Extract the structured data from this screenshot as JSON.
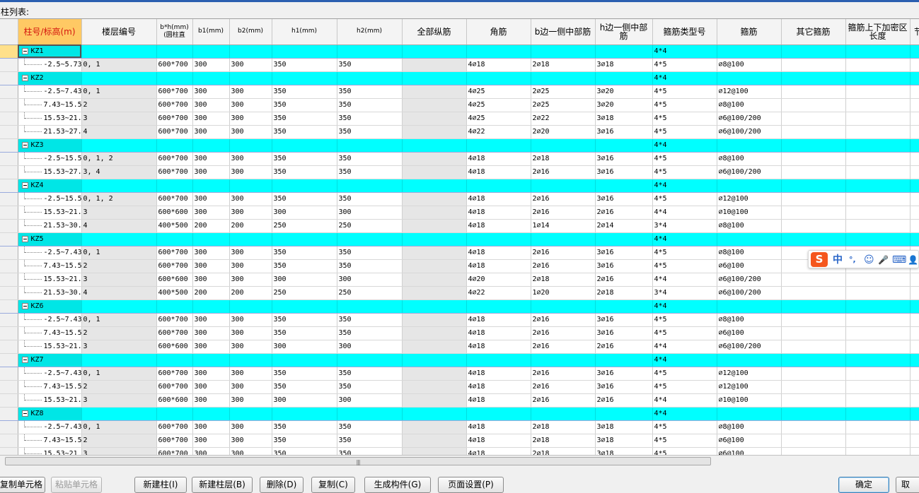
{
  "caption": "柱列表:",
  "columns": [
    {
      "label": "柱号/标高(m)",
      "cls": "first"
    },
    {
      "label": "楼层编号",
      "cls": ""
    },
    {
      "label": "b*h(mm)(圆柱直",
      "cls": "small"
    },
    {
      "label": "b1(mm)",
      "cls": "small"
    },
    {
      "label": "b2(mm)",
      "cls": "small"
    },
    {
      "label": "h1(mm)",
      "cls": "small"
    },
    {
      "label": "h2(mm)",
      "cls": "small"
    },
    {
      "label": "全部纵筋",
      "cls": ""
    },
    {
      "label": "角筋",
      "cls": ""
    },
    {
      "label": "b边一侧中部筋",
      "cls": ""
    },
    {
      "label": "h边一侧中部筋",
      "cls": ""
    },
    {
      "label": "箍筋类型号",
      "cls": ""
    },
    {
      "label": "箍筋",
      "cls": ""
    },
    {
      "label": "其它箍筋",
      "cls": ""
    },
    {
      "label": "箍筋上下加密区长度",
      "cls": ""
    },
    {
      "label": "节",
      "cls": ""
    }
  ],
  "groups": [
    {
      "name": "KZ1",
      "hoop_type": "4*4",
      "selected": true,
      "rows": [
        {
          "elev": "-2.5~5.73",
          "floor": "0, 1",
          "bh": "600*700",
          "b1": "300",
          "b2": "300",
          "h1": "350",
          "h2": "350",
          "all": "",
          "corner": "4⌀18",
          "bmid": "2⌀18",
          "hmid": "3⌀18",
          "htype": "4*5",
          "stirrup": "⌀8@100"
        }
      ]
    },
    {
      "name": "KZ2",
      "hoop_type": "4*4",
      "selected": false,
      "rows": [
        {
          "elev": "-2.5~7.43",
          "floor": "0, 1",
          "bh": "600*700",
          "b1": "300",
          "b2": "300",
          "h1": "350",
          "h2": "350",
          "all": "",
          "corner": "4⌀25",
          "bmid": "2⌀25",
          "hmid": "3⌀20",
          "htype": "4*5",
          "stirrup": "⌀12@100"
        },
        {
          "elev": "7.43~15.5",
          "floor": "2",
          "bh": "600*700",
          "b1": "300",
          "b2": "300",
          "h1": "350",
          "h2": "350",
          "all": "",
          "corner": "4⌀25",
          "bmid": "2⌀25",
          "hmid": "3⌀20",
          "htype": "4*5",
          "stirrup": "⌀8@100"
        },
        {
          "elev": "15.53~21.",
          "floor": "3",
          "bh": "600*700",
          "b1": "300",
          "b2": "300",
          "h1": "350",
          "h2": "350",
          "all": "",
          "corner": "4⌀25",
          "bmid": "2⌀22",
          "hmid": "3⌀18",
          "htype": "4*5",
          "stirrup": "⌀6@100/200"
        },
        {
          "elev": "21.53~27.",
          "floor": "4",
          "bh": "600*700",
          "b1": "300",
          "b2": "300",
          "h1": "350",
          "h2": "350",
          "all": "",
          "corner": "4⌀22",
          "bmid": "2⌀20",
          "hmid": "3⌀16",
          "htype": "4*5",
          "stirrup": "⌀6@100/200"
        }
      ]
    },
    {
      "name": "KZ3",
      "hoop_type": "4*4",
      "selected": false,
      "rows": [
        {
          "elev": "-2.5~15.5",
          "floor": "0, 1, 2",
          "bh": "600*700",
          "b1": "300",
          "b2": "300",
          "h1": "350",
          "h2": "350",
          "all": "",
          "corner": "4⌀18",
          "bmid": "2⌀18",
          "hmid": "3⌀16",
          "htype": "4*5",
          "stirrup": "⌀8@100"
        },
        {
          "elev": "15.53~27.",
          "floor": "3, 4",
          "bh": "600*700",
          "b1": "300",
          "b2": "300",
          "h1": "350",
          "h2": "350",
          "all": "",
          "corner": "4⌀18",
          "bmid": "2⌀16",
          "hmid": "3⌀16",
          "htype": "4*5",
          "stirrup": "⌀6@100/200"
        }
      ]
    },
    {
      "name": "KZ4",
      "hoop_type": "4*4",
      "selected": false,
      "rows": [
        {
          "elev": "-2.5~15.5",
          "floor": "0, 1, 2",
          "bh": "600*700",
          "b1": "300",
          "b2": "300",
          "h1": "350",
          "h2": "350",
          "all": "",
          "corner": "4⌀18",
          "bmid": "2⌀16",
          "hmid": "3⌀16",
          "htype": "4*5",
          "stirrup": "⌀12@100"
        },
        {
          "elev": "15.53~21.",
          "floor": "3",
          "bh": "600*600",
          "b1": "300",
          "b2": "300",
          "h1": "300",
          "h2": "300",
          "all": "",
          "corner": "4⌀18",
          "bmid": "2⌀16",
          "hmid": "2⌀16",
          "htype": "4*4",
          "stirrup": "⌀10@100"
        },
        {
          "elev": "21.53~30.",
          "floor": "4",
          "bh": "400*500",
          "b1": "200",
          "b2": "200",
          "h1": "250",
          "h2": "250",
          "all": "",
          "corner": "4⌀18",
          "bmid": "1⌀14",
          "hmid": "2⌀14",
          "htype": "3*4",
          "stirrup": "⌀8@100"
        }
      ]
    },
    {
      "name": "KZ5",
      "hoop_type": "4*4",
      "selected": false,
      "rows": [
        {
          "elev": "-2.5~7.43",
          "floor": "0, 1",
          "bh": "600*700",
          "b1": "300",
          "b2": "300",
          "h1": "350",
          "h2": "350",
          "all": "",
          "corner": "4⌀18",
          "bmid": "2⌀16",
          "hmid": "3⌀16",
          "htype": "4*5",
          "stirrup": "⌀8@100"
        },
        {
          "elev": "7.43~15.5",
          "floor": "2",
          "bh": "600*700",
          "b1": "300",
          "b2": "300",
          "h1": "350",
          "h2": "350",
          "all": "",
          "corner": "4⌀18",
          "bmid": "2⌀16",
          "hmid": "3⌀16",
          "htype": "4*5",
          "stirrup": "⌀6@100"
        },
        {
          "elev": "15.53~21.",
          "floor": "3",
          "bh": "600*600",
          "b1": "300",
          "b2": "300",
          "h1": "300",
          "h2": "300",
          "all": "",
          "corner": "4⌀20",
          "bmid": "2⌀18",
          "hmid": "2⌀16",
          "htype": "4*4",
          "stirrup": "⌀6@100/200"
        },
        {
          "elev": "21.53~30.",
          "floor": "4",
          "bh": "400*500",
          "b1": "200",
          "b2": "200",
          "h1": "250",
          "h2": "250",
          "all": "",
          "corner": "4⌀22",
          "bmid": "1⌀20",
          "hmid": "2⌀18",
          "htype": "3*4",
          "stirrup": "⌀6@100/200"
        }
      ]
    },
    {
      "name": "KZ6",
      "hoop_type": "4*4",
      "selected": false,
      "rows": [
        {
          "elev": "-2.5~7.43",
          "floor": "0, 1",
          "bh": "600*700",
          "b1": "300",
          "b2": "300",
          "h1": "350",
          "h2": "350",
          "all": "",
          "corner": "4⌀18",
          "bmid": "2⌀16",
          "hmid": "3⌀16",
          "htype": "4*5",
          "stirrup": "⌀8@100"
        },
        {
          "elev": "7.43~15.5",
          "floor": "2",
          "bh": "600*700",
          "b1": "300",
          "b2": "300",
          "h1": "350",
          "h2": "350",
          "all": "",
          "corner": "4⌀18",
          "bmid": "2⌀16",
          "hmid": "3⌀16",
          "htype": "4*5",
          "stirrup": "⌀6@100"
        },
        {
          "elev": "15.53~21.",
          "floor": "3",
          "bh": "600*600",
          "b1": "300",
          "b2": "300",
          "h1": "300",
          "h2": "300",
          "all": "",
          "corner": "4⌀18",
          "bmid": "2⌀16",
          "hmid": "2⌀16",
          "htype": "4*4",
          "stirrup": "⌀6@100/200"
        }
      ]
    },
    {
      "name": "KZ7",
      "hoop_type": "4*4",
      "selected": false,
      "rows": [
        {
          "elev": "-2.5~7.43",
          "floor": "0, 1",
          "bh": "600*700",
          "b1": "300",
          "b2": "300",
          "h1": "350",
          "h2": "350",
          "all": "",
          "corner": "4⌀18",
          "bmid": "2⌀16",
          "hmid": "3⌀16",
          "htype": "4*5",
          "stirrup": "⌀12@100"
        },
        {
          "elev": "7.43~15.5",
          "floor": "2",
          "bh": "600*700",
          "b1": "300",
          "b2": "300",
          "h1": "350",
          "h2": "350",
          "all": "",
          "corner": "4⌀18",
          "bmid": "2⌀16",
          "hmid": "3⌀16",
          "htype": "4*5",
          "stirrup": "⌀12@100"
        },
        {
          "elev": "15.53~21.",
          "floor": "3",
          "bh": "600*600",
          "b1": "300",
          "b2": "300",
          "h1": "300",
          "h2": "300",
          "all": "",
          "corner": "4⌀18",
          "bmid": "2⌀16",
          "hmid": "2⌀16",
          "htype": "4*4",
          "stirrup": "⌀10@100"
        }
      ]
    },
    {
      "name": "KZ8",
      "hoop_type": "4*4",
      "selected": false,
      "rows": [
        {
          "elev": "-2.5~7.43",
          "floor": "0, 1",
          "bh": "600*700",
          "b1": "300",
          "b2": "300",
          "h1": "350",
          "h2": "350",
          "all": "",
          "corner": "4⌀18",
          "bmid": "2⌀18",
          "hmid": "3⌀18",
          "htype": "4*5",
          "stirrup": "⌀8@100"
        },
        {
          "elev": "7.43~15.5",
          "floor": "2",
          "bh": "600*700",
          "b1": "300",
          "b2": "300",
          "h1": "350",
          "h2": "350",
          "all": "",
          "corner": "4⌀18",
          "bmid": "2⌀18",
          "hmid": "3⌀18",
          "htype": "4*5",
          "stirrup": "⌀6@100"
        },
        {
          "elev": "15.53~21",
          "floor": "3",
          "bh": "600*700",
          "b1": "300",
          "b2": "300",
          "h1": "350",
          "h2": "350",
          "all": "",
          "corner": "4⌀18",
          "bmid": "2⌀18",
          "hmid": "3⌀18",
          "htype": "4*5",
          "stirrup": "⌀6@100"
        }
      ]
    }
  ],
  "buttons": {
    "copy_cell": "复制单元格",
    "paste_cell": "粘贴单元格",
    "new_column": "新建柱(I)",
    "new_layer": "新建柱层(B)",
    "delete": "删除(D)",
    "copy": "复制(C)",
    "generate": "生成构件(G)",
    "page_setup": "页面设置(P)",
    "ok": "确定",
    "cancel": "取"
  },
  "ime": {
    "logo": "S",
    "mode": "中",
    "punct": "°,",
    "face": "☺",
    "mic": "🎤",
    "kbd": "⌨",
    "user": "👤"
  },
  "colors": {
    "group_row": "#00ffff",
    "header_selected": "#ffc964",
    "header_selected_text": "#d4160e",
    "ime_brand": "#f5561d"
  }
}
